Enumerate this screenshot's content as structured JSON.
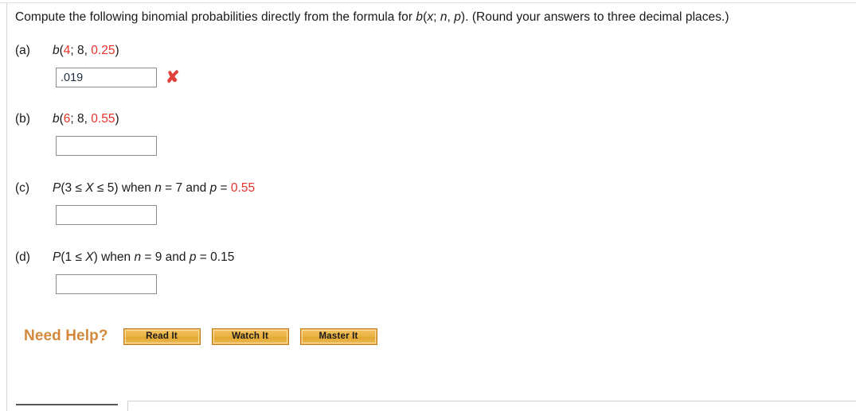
{
  "question": {
    "text_before_formula": "Compute the following binomial probabilities directly from the formula for ",
    "formula_b": "b",
    "formula_args_open": "(",
    "formula_x": "x",
    "formula_semi": "; ",
    "formula_n": "n",
    "formula_comma": ", ",
    "formula_p": "p",
    "formula_close": ")",
    "text_after_formula": ". (Round your answers to three decimal places.)"
  },
  "parts": [
    {
      "label": "(a)",
      "func": "b",
      "open": "(",
      "x": "4",
      "sep1": "; ",
      "n": "8",
      "sep2": ", ",
      "p": "0.25",
      "close": ")",
      "x_red": true,
      "n_red": false,
      "p_red": true,
      "answer_value": ".019",
      "answer_placeholder": "",
      "graded": true,
      "grade_mark": "✘"
    },
    {
      "label": "(b)",
      "func": "b",
      "open": "(",
      "x": "6",
      "sep1": "; ",
      "n": "8",
      "sep2": ", ",
      "p": "0.55",
      "close": ")",
      "x_red": true,
      "n_red": false,
      "p_red": true,
      "answer_value": "",
      "answer_placeholder": "",
      "graded": false,
      "grade_mark": ""
    }
  ],
  "parts_prob": [
    {
      "label": "(c)",
      "func": "P",
      "open": "(",
      "lower": "3",
      "rel1": " ≤ ",
      "variable": "X",
      "rel2": " ≤ ",
      "upper": "5",
      "close": ")",
      "when": " when ",
      "n_sym": "n",
      "n_eq": " = ",
      "n_val": "7",
      "and": " and ",
      "p_sym": "p",
      "p_eq": " = ",
      "p_val": "0.55",
      "p_red": true,
      "answer_value": "",
      "answer_placeholder": ""
    },
    {
      "label": "(d)",
      "func": "P",
      "open": "(",
      "lower": "1",
      "rel1": " ≤ ",
      "variable": "X",
      "rel2": "",
      "upper": "",
      "close": ")",
      "when": " when ",
      "n_sym": "n",
      "n_eq": " = ",
      "n_val": "9",
      "and": " and ",
      "p_sym": "p",
      "p_eq": " = ",
      "p_val": "0.15",
      "p_red": false,
      "answer_value": "",
      "answer_placeholder": ""
    }
  ],
  "need_help": {
    "label": "Need Help?",
    "buttons": [
      {
        "label": "Read It"
      },
      {
        "label": "Watch It"
      },
      {
        "label": "Master It"
      }
    ]
  },
  "colors": {
    "given_value_red": "#e8322a",
    "wrong_mark_red": "#e0413a",
    "need_help_orange": "#d2893c",
    "button_border": "#c07c1e"
  }
}
